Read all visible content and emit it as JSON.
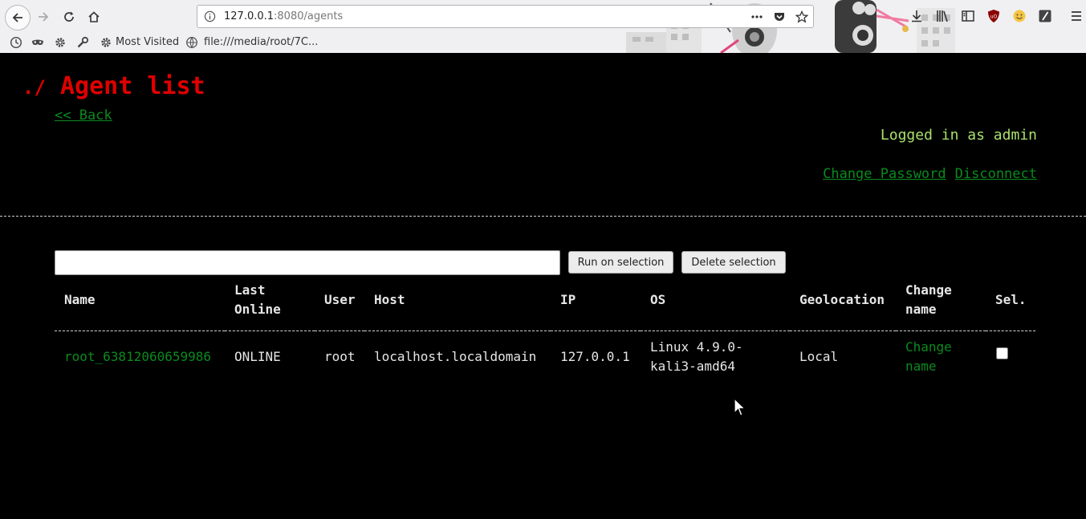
{
  "browser": {
    "url_host": "127.0.0.1",
    "url_rest": ":8080/agents",
    "bookmarks": {
      "most_visited": "Most Visited",
      "file_link": "file:///media/root/7C..."
    },
    "icons": [
      "back-icon",
      "forward-icon",
      "reload-icon",
      "home-icon",
      "info-icon",
      "more-icon",
      "pocket-icon",
      "star-icon",
      "download-icon",
      "library-icon",
      "sidebar-icon",
      "ublock-icon",
      "emoji-icon",
      "extension-icon",
      "menu-icon",
      "history-icon",
      "mask-icon",
      "gear-icon",
      "wrench-icon",
      "globe-icon"
    ]
  },
  "page": {
    "title_prefix": "./",
    "title": "Agent list",
    "back_link": "<< Back",
    "logged_in": "Logged in as admin",
    "change_password": "Change Password",
    "disconnect": "Disconnect",
    "command_value": "",
    "run_button": "Run on selection",
    "delete_button": "Delete selection",
    "colors": {
      "title": "#e00000",
      "link": "#0a8a1e",
      "logged": "#a8e06c",
      "background": "#000000"
    }
  },
  "table": {
    "headers": {
      "name": "Name",
      "last_online_1": "Last",
      "last_online_2": "Online",
      "user": "User",
      "host": "Host",
      "ip": "IP",
      "os": "OS",
      "geolocation": "Geolocation",
      "change_name_1": "Change",
      "change_name_2": "name",
      "sel": "Sel."
    },
    "rows": [
      {
        "name": "root_63812060659986",
        "last_online": "ONLINE",
        "user": "root",
        "host": "localhost.localdomain",
        "ip": "127.0.0.1",
        "os_1": "Linux 4.9.0-",
        "os_2": "kali3-amd64",
        "geolocation": "Local",
        "change_1": "Change",
        "change_2": "name",
        "selected": false
      }
    ]
  }
}
